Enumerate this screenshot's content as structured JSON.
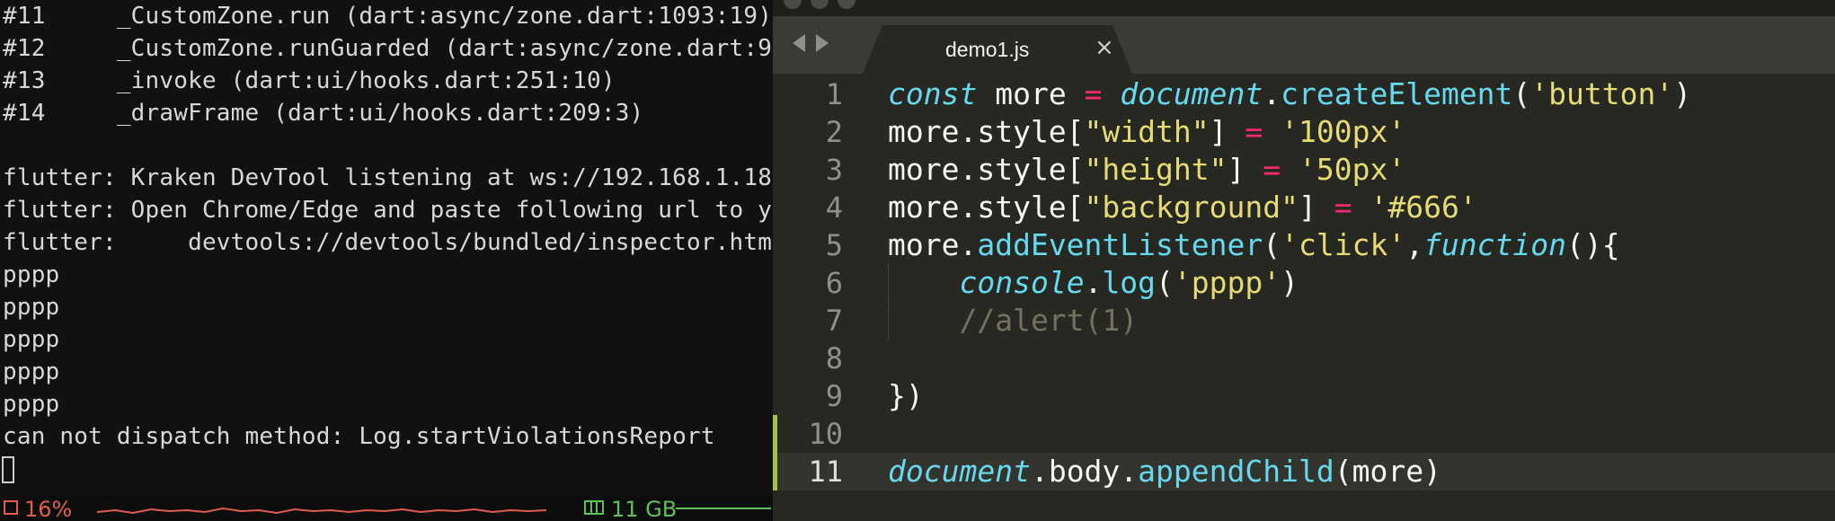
{
  "terminal": {
    "lines": [
      "#11     _CustomZone.run (dart:async/zone.dart:1093:19)",
      "#12     _CustomZone.runGuarded (dart:async/zone.dart:9",
      "#13     _invoke (dart:ui/hooks.dart:251:10)",
      "#14     _drawFrame (dart:ui/hooks.dart:209:3)",
      "",
      "flutter: Kraken DevTool listening at ws://192.168.1.18",
      "flutter: Open Chrome/Edge and paste following url to y",
      "flutter:     devtools://devtools/bundled/inspector.htm",
      "pppp",
      "pppp",
      "pppp",
      "pppp",
      "pppp",
      "can not dispatch method: Log.startViolationsReport"
    ],
    "status": {
      "cpu_label": "16%",
      "cpu_color": "#e05c50",
      "mem_label": "11 GB",
      "mem_color": "#5fbf57",
      "cpu_icon": "cpu-chip-icon",
      "mem_icon": "memory-icon"
    }
  },
  "editor": {
    "tab": {
      "label": "demo1.js",
      "close_glyph": "×"
    },
    "nav": {
      "back_icon": "chevron-left-icon",
      "forward_icon": "chevron-right-icon"
    },
    "active_line": 11,
    "modified_lines": [
      10,
      11
    ],
    "code": [
      [
        {
          "t": "const",
          "c": "stor"
        },
        {
          "t": " more ",
          "c": "plain"
        },
        {
          "t": "=",
          "c": "op"
        },
        {
          "t": " ",
          "c": "plain"
        },
        {
          "t": "document",
          "c": "stor"
        },
        {
          "t": ".",
          "c": "plain"
        },
        {
          "t": "createElement",
          "c": "fn"
        },
        {
          "t": "(",
          "c": "plain"
        },
        {
          "t": "'button'",
          "c": "str"
        },
        {
          "t": ")",
          "c": "plain"
        }
      ],
      [
        {
          "t": "more.style[",
          "c": "plain"
        },
        {
          "t": "\"width\"",
          "c": "str"
        },
        {
          "t": "] ",
          "c": "plain"
        },
        {
          "t": "=",
          "c": "op"
        },
        {
          "t": " ",
          "c": "plain"
        },
        {
          "t": "'100px'",
          "c": "str"
        }
      ],
      [
        {
          "t": "more.style[",
          "c": "plain"
        },
        {
          "t": "\"height\"",
          "c": "str"
        },
        {
          "t": "] ",
          "c": "plain"
        },
        {
          "t": "=",
          "c": "op"
        },
        {
          "t": " ",
          "c": "plain"
        },
        {
          "t": "'50px'",
          "c": "str"
        }
      ],
      [
        {
          "t": "more.style[",
          "c": "plain"
        },
        {
          "t": "\"background\"",
          "c": "str"
        },
        {
          "t": "] ",
          "c": "plain"
        },
        {
          "t": "=",
          "c": "op"
        },
        {
          "t": " ",
          "c": "plain"
        },
        {
          "t": "'#666'",
          "c": "str"
        }
      ],
      [
        {
          "t": "more.",
          "c": "plain"
        },
        {
          "t": "addEventListener",
          "c": "fn"
        },
        {
          "t": "(",
          "c": "plain"
        },
        {
          "t": "'click'",
          "c": "str"
        },
        {
          "t": ",",
          "c": "plain"
        },
        {
          "t": "function",
          "c": "stor"
        },
        {
          "t": "(){",
          "c": "plain"
        }
      ],
      [
        {
          "t": "    ",
          "c": "plain"
        },
        {
          "t": "console",
          "c": "stor"
        },
        {
          "t": ".",
          "c": "plain"
        },
        {
          "t": "log",
          "c": "fn"
        },
        {
          "t": "(",
          "c": "plain"
        },
        {
          "t": "'pppp'",
          "c": "str"
        },
        {
          "t": ")",
          "c": "plain"
        }
      ],
      [
        {
          "t": "    ",
          "c": "plain"
        },
        {
          "t": "//alert(1)",
          "c": "cmt"
        }
      ],
      [],
      [
        {
          "t": "})",
          "c": "plain"
        }
      ],
      [],
      [
        {
          "t": "document",
          "c": "stor"
        },
        {
          "t": ".body.",
          "c": "plain"
        },
        {
          "t": "appendChild",
          "c": "fn"
        },
        {
          "t": "(more)",
          "c": "plain"
        }
      ]
    ]
  }
}
